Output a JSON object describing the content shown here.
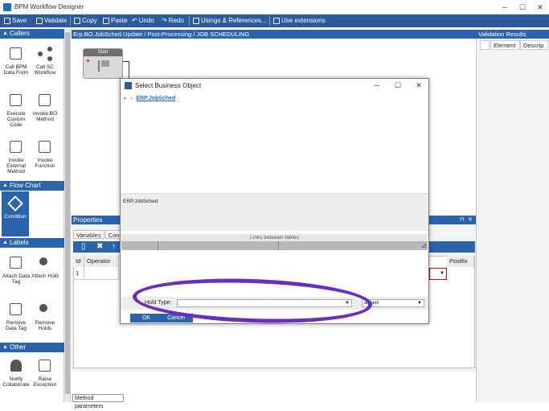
{
  "window": {
    "title": "BPM Workflow Designer",
    "minimize": "─",
    "maximize": "☐",
    "close": "✕"
  },
  "toolbar": {
    "save": "Save",
    "validate": "Validate",
    "copy": "Copy",
    "paste": "Paste",
    "undo": "Undo",
    "redo": "Redo",
    "usings": "Usings & References...",
    "extensions": "Use extensions"
  },
  "sidebar": {
    "callers_header": "Callers",
    "callers": [
      {
        "label": "Call BPM Data Form",
        "icon": "data-form-icon"
      },
      {
        "label": "Call SC Workflow",
        "icon": "workflow-icon"
      },
      {
        "label": "Execute Custom Code",
        "icon": "custom-code-icon"
      },
      {
        "label": "Invoke BO Method",
        "icon": "bo-method-icon"
      },
      {
        "label": "Invoke External Method",
        "icon": "external-method-icon"
      },
      {
        "label": "Invoke Function",
        "icon": "function-icon"
      }
    ],
    "flow_header": "Flow Chart",
    "flow": [
      {
        "label": "Condition",
        "icon": "condition-icon"
      }
    ],
    "labels_header": "Labels",
    "labels": [
      {
        "label": "Attach Data Tag",
        "icon": "data-tag-icon"
      },
      {
        "label": "Attach Hold",
        "icon": "hold-icon"
      },
      {
        "label": "Remove Data Tag",
        "icon": "remove-tag-icon"
      },
      {
        "label": "Remove Holds",
        "icon": "remove-hold-icon"
      }
    ],
    "other_header": "Other",
    "other": [
      {
        "label": "Notify Collaborate",
        "icon": "bell-icon"
      },
      {
        "label": "Raise Exception",
        "icon": "exception-icon"
      }
    ]
  },
  "breadcrumb": "Erp.BO.JobSched.Update / Post-Processing / JOB SCHEDULING",
  "canvas": {
    "start_label": "Start"
  },
  "properties": {
    "header": "Properties",
    "tabs": [
      "Variables",
      "Condi"
    ],
    "columns": [
      "Id",
      "Operator"
    ],
    "postfix": "Postfix",
    "row_id": "1"
  },
  "validation": {
    "header": "Validation Results",
    "columns": [
      "Element",
      "Descrip"
    ]
  },
  "bottom_tab": "Method parameters",
  "dialog": {
    "title": "Select Business Object",
    "tree_node": "ERP.JobSched",
    "description": "ERP.JobSched",
    "links_header": "Links between tables",
    "hold_type_label": "Hold Type:",
    "hold_type_value": "",
    "attach_value": "ached",
    "ok": "OK",
    "cancel": "Cancel"
  },
  "colors": {
    "accent": "#2b64ad",
    "toolbar": "#2b5b9a",
    "annotation": "#6a2ec0"
  }
}
